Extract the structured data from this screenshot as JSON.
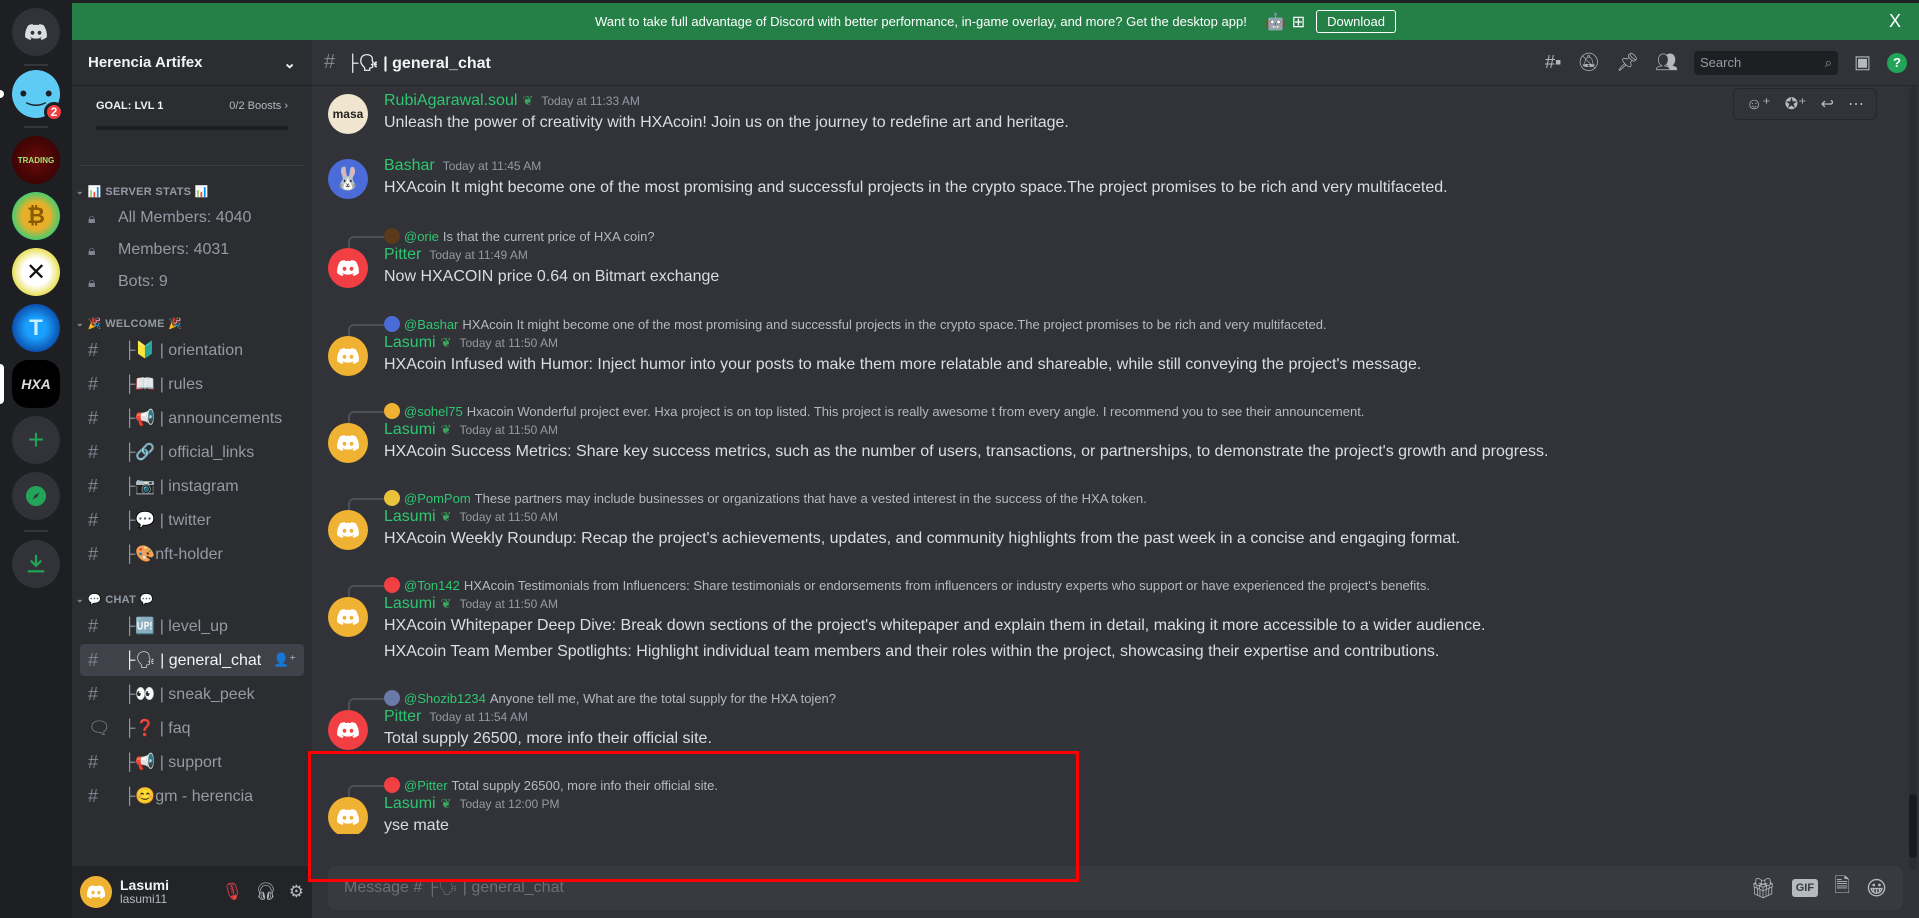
{
  "banner": {
    "text": "Want to take full advantage of Discord with better performance, in-game overlay, and more? Get the desktop app!",
    "icons": [
      "apple-icon",
      "android-icon",
      "windows-icon"
    ],
    "download_label": "Download",
    "close_label": "X",
    "color": "#248046"
  },
  "rail": {
    "servers": [
      {
        "name": "home",
        "icon": "discord-logo"
      },
      {
        "name": "smiley-server",
        "badge": "2"
      },
      {
        "name": "trading-community",
        "text": "TRADING"
      },
      {
        "name": "bitcoin-server",
        "text": "₿"
      },
      {
        "name": "x-server",
        "text": "✕"
      },
      {
        "name": "t-server",
        "text": "T"
      },
      {
        "name": "hxa-server",
        "text": "HXA",
        "selected": true
      }
    ],
    "add_server": "+",
    "explore": "compass-icon",
    "download_apps": "download-icon"
  },
  "sidebar": {
    "server_name": "Herencia Artifex",
    "goal_label": "GOAL: LVL 1",
    "boosts": "0/2 Boosts",
    "boost_progress": 0,
    "categories": [
      {
        "name": "📊 SERVER STATS 📊",
        "stats": [
          "All Members: 4040",
          "Members: 4031",
          "Bots: 9"
        ]
      },
      {
        "name": "🎉 WELCOME 🎉",
        "channels": [
          "├🔰 | orientation",
          "├📖 | rules",
          "├📢 | announcements",
          "├🔗 | official_links",
          "├📷 | instagram",
          "├💬 | twitter",
          "├🎨nft-holder"
        ]
      },
      {
        "name": "💬 CHAT 💬",
        "channels": [
          "├🆙 | level_up",
          "├🗣 | general_chat",
          "├👀 | sneak_peek",
          "├❓ | faq",
          "├📢 | support",
          "├😊gm - herencia"
        ]
      }
    ],
    "active_channel": "├🗣 | general_chat"
  },
  "user": {
    "display_name": "Lasumi",
    "username": "lasumi11"
  },
  "header": {
    "channel_title": "├🗣 | general_chat",
    "search_placeholder": "Search"
  },
  "messages": [
    {
      "author": "RubiAgarawal.soul",
      "avatar_text": "masa",
      "avatar_color": "#f0e6d0",
      "time": "Today at 11:33 AM",
      "lines": [
        "Unleash the power of creativity with HXAcoin! Join us on the journey to redefine art and heritage."
      ]
    },
    {
      "author": "Bashar",
      "avatar_text": "🐰",
      "avatar_color": "#4b6bd8",
      "time": "Today at 11:45 AM",
      "lines": [
        "HXAcoin It might become one of the most promising and successful projects in the crypto space.The project promises to be rich and very multifaceted."
      ]
    },
    {
      "reply_to": "@orie",
      "reply_text": "Is that the current price of HXA coin?",
      "author": "Pitter",
      "avatar_color": "#f23f43",
      "time": "Today at 11:49 AM",
      "lines": [
        "Now HXACOIN price 0.64 on Bitmart exchange"
      ]
    },
    {
      "reply_to": "@Bashar",
      "reply_text": "HXAcoin It might become one of the most promising and successful projects in the crypto space.The project promises to be rich and very multifaceted.",
      "author": "Lasumi",
      "avatar_color": "#f0b232",
      "time": "Today at 11:50 AM",
      "lines": [
        "HXAcoin Infused with Humor: Inject humor into your posts to make them more relatable and shareable, while still conveying the project's message."
      ]
    },
    {
      "reply_to": "@sohel75",
      "reply_text": "Hxacoin Wonderful project ever. Hxa project is on top listed. This project is really awesome t from every angle. I recommend you to see their announcement.",
      "author": "Lasumi",
      "avatar_color": "#f0b232",
      "time": "Today at 11:50 AM",
      "lines": [
        "HXAcoin Success Metrics: Share key success metrics, such as the number of users, transactions, or partnerships, to demonstrate the project's growth and progress."
      ]
    },
    {
      "reply_to": "@PomPom",
      "reply_text": "These partners may include businesses or organizations that have a vested interest in the success of the HXA token.",
      "author": "Lasumi",
      "avatar_color": "#f0b232",
      "time": "Today at 11:50 AM",
      "lines": [
        "HXAcoin Weekly Roundup: Recap the project's achievements, updates, and community highlights from the past week in a concise and engaging format."
      ]
    },
    {
      "reply_to": "@Ton142",
      "reply_text": "HXAcoin Testimonials from Influencers: Share testimonials or endorsements from influencers or industry experts who support or have experienced the project's benefits.",
      "author": "Lasumi",
      "avatar_color": "#f0b232",
      "time": "Today at 11:50 AM",
      "lines": [
        "HXAcoin Whitepaper Deep Dive: Break down sections of the project's whitepaper and explain them in detail, making it more accessible to a wider audience.",
        "HXAcoin Team Member Spotlights: Highlight individual team members and their roles within the project, showcasing their expertise and contributions."
      ]
    },
    {
      "reply_to": "@Shozib1234",
      "reply_text": "Anyone tell me, What are the total supply for the HXA tojen?",
      "author": "Pitter",
      "avatar_color": "#f23f43",
      "time": "Today at 11:54 AM",
      "lines": [
        "Total supply 26500, more info their official site."
      ]
    },
    {
      "reply_to": "@Pitter",
      "reply_text": "Total supply 26500, more info their official site.",
      "author": "Lasumi",
      "avatar_color": "#f0b232",
      "time": "Today at 12:00 PM",
      "lines": [
        "yse mate"
      ]
    }
  ],
  "composer": {
    "placeholder": "Message # ├🗣 | general_chat",
    "gif_label": "GIF"
  }
}
